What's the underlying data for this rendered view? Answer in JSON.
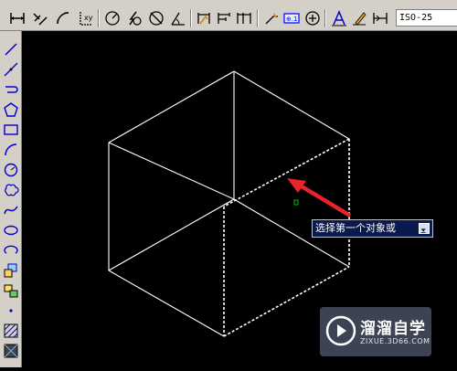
{
  "toolbar": {
    "dim_style": "ISO-25",
    "icons": [
      "linear-dimension-icon",
      "aligned-dimension-icon",
      "arc-length-icon",
      "ordinate-icon",
      "radius-icon",
      "jogged-icon",
      "diameter-icon",
      "angular-icon",
      "quick-dimension-icon",
      "baseline-icon",
      "continue-icon",
      "quick-leader-icon",
      "tolerance-icon",
      "center-mark-icon",
      "dimension-edit-icon",
      "dimension-text-edit-icon",
      "dimension-update-icon"
    ]
  },
  "left_toolbar": {
    "icons": [
      "line-icon",
      "construction-line-icon",
      "polyline-icon",
      "polygon-icon",
      "rectangle-icon",
      "arc-icon",
      "circle-icon",
      "revision-cloud-icon",
      "spline-icon",
      "ellipse-icon",
      "ellipse-arc-icon",
      "insert-block-icon",
      "make-block-icon",
      "point-icon",
      "hatch-icon",
      "gradient-icon"
    ]
  },
  "prompt": {
    "text": "选择第一个对象或",
    "arrow_icon": "down-arrow-icon"
  },
  "watermark": {
    "title": "溜溜自学",
    "url": "ZIXUE.3D66.COM"
  },
  "colors": {
    "canvas": "#000000",
    "lines": "#ffffff",
    "arrow": "#e8242a",
    "tooltip_bg": "#0a1a4e",
    "cursor": "#00c000"
  }
}
